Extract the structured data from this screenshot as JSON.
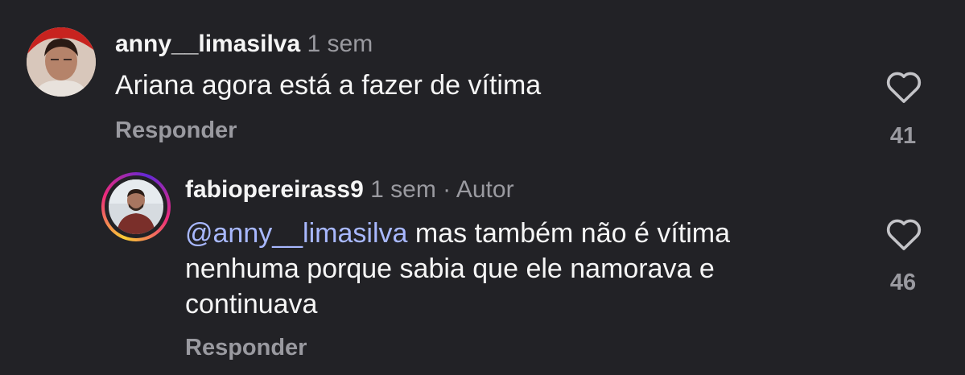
{
  "comments": [
    {
      "username": "anny__limasilva",
      "time": "1 sem",
      "text": "Ariana agora está a fazer de vítima",
      "reply_label": "Responder",
      "likes": "41",
      "like_icon": "heart-outline-icon"
    }
  ],
  "reply": {
    "username": "fabiopereirass9",
    "time": "1 sem",
    "separator": "·",
    "author_label": "Autor",
    "mention": "@anny__limasilva",
    "text_line1": " mas também não é vítima",
    "text_line2": "nenhuma porque sabia que ele namorava e",
    "text_line3": "continuava",
    "reply_label": "Responder",
    "likes": "46",
    "like_icon": "heart-outline-icon",
    "story_ring_colors": [
      "#f9ce34",
      "#ee2a7b",
      "#6228d7"
    ]
  },
  "colors": {
    "background": "#222226",
    "text": "#f5f5f5",
    "muted": "#9a9aa0",
    "mention": "#a8b8ff"
  }
}
